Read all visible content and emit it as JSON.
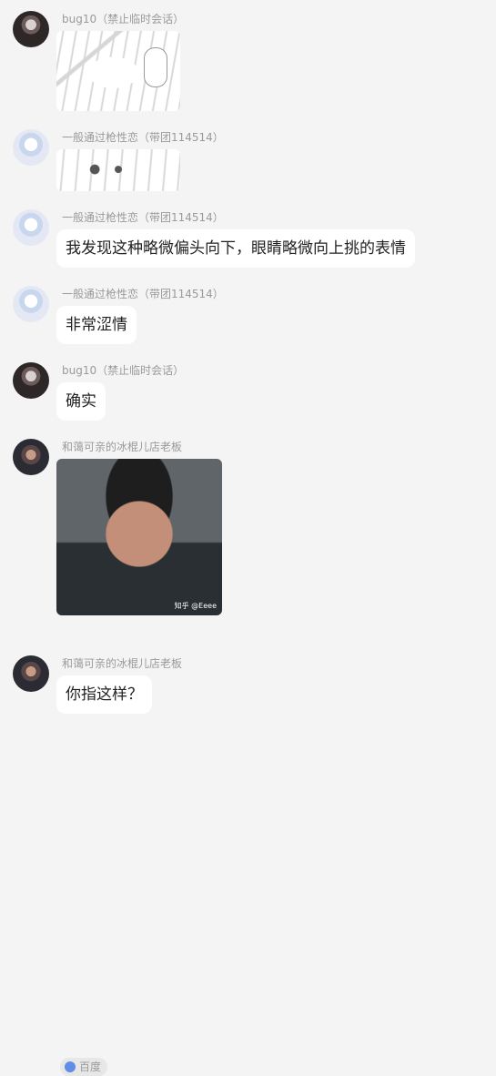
{
  "messages": [
    {
      "sender": "bug10（禁止临时会话）"
    },
    {
      "sender": "一般通过枪性恋（带团114514）"
    },
    {
      "sender": "一般通过枪性恋（带团114514）",
      "text": "我发现这种略微偏头向下，眼睛略微向上挑的表情"
    },
    {
      "sender": "一般通过枪性恋（带团114514）",
      "text": "非常涩情"
    },
    {
      "sender": "bug10（禁止临时会话）",
      "text": "确实"
    },
    {
      "sender": "和蔼可亲的冰棍儿店老板",
      "caption": "知乎 @Eeee",
      "tag": "百度"
    },
    {
      "sender": "和蔼可亲的冰棍儿店老板",
      "text": "你指这样？"
    }
  ]
}
